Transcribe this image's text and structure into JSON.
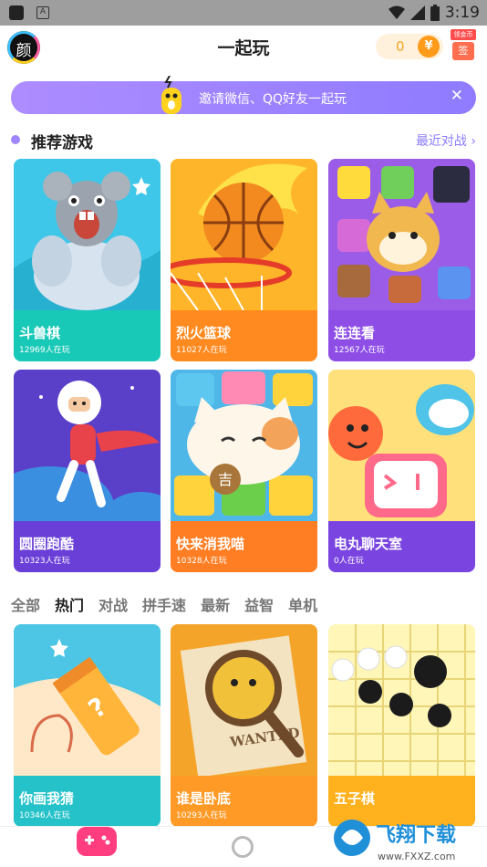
{
  "status_bar": {
    "left_icon": "A",
    "time": "3:19"
  },
  "header": {
    "avatar_text": "颜",
    "title": "一起玩",
    "coins": "0",
    "coin_symbol": "¥",
    "sign_tag": "领金币",
    "sign_label": "签"
  },
  "banner": {
    "text": "邀请微信、QQ好友一起玩",
    "close": "✕"
  },
  "recommended": {
    "title": "推荐游戏",
    "recent": "最近对战 ›"
  },
  "recommended_games": [
    {
      "name": "斗兽棋",
      "players": "12969人在玩"
    },
    {
      "name": "烈火篮球",
      "players": "11027人在玩"
    },
    {
      "name": "连连看",
      "players": "12567人在玩"
    },
    {
      "name": "圆圈跑酷",
      "players": "10323人在玩"
    },
    {
      "name": "快来消我喵",
      "players": "10328人在玩",
      "art_char": "吉"
    },
    {
      "name": "电丸聊天室",
      "players": "0人在玩"
    }
  ],
  "category_tabs": [
    "全部",
    "热门",
    "对战",
    "拼手速",
    "最新",
    "益智",
    "单机"
  ],
  "hot_games": [
    {
      "name": "你画我猜",
      "players": "10346人在玩",
      "art_char": "?"
    },
    {
      "name": "谁是卧底",
      "players": "10293人在玩",
      "art_text": "WANTED"
    },
    {
      "name": "五子棋"
    }
  ],
  "watermark": {
    "title": "飞翔下载",
    "url": "www.FXXZ.com"
  },
  "colors": {
    "accent": "#8f7bff",
    "coin": "#ff9b1a",
    "card_footers": [
      "#19c9b7",
      "#ff8a1f",
      "#8e4ee6",
      "#6a3fd8",
      "#ff7e23",
      "#7a44e0",
      "#25c2c9",
      "#ff9a26",
      "#ffb21e"
    ]
  },
  "icons": [
    "signal-icon",
    "wifi-icon",
    "battery-icon",
    "coin-icon",
    "close-icon",
    "gamepad-icon",
    "circle-nav-icon"
  ]
}
